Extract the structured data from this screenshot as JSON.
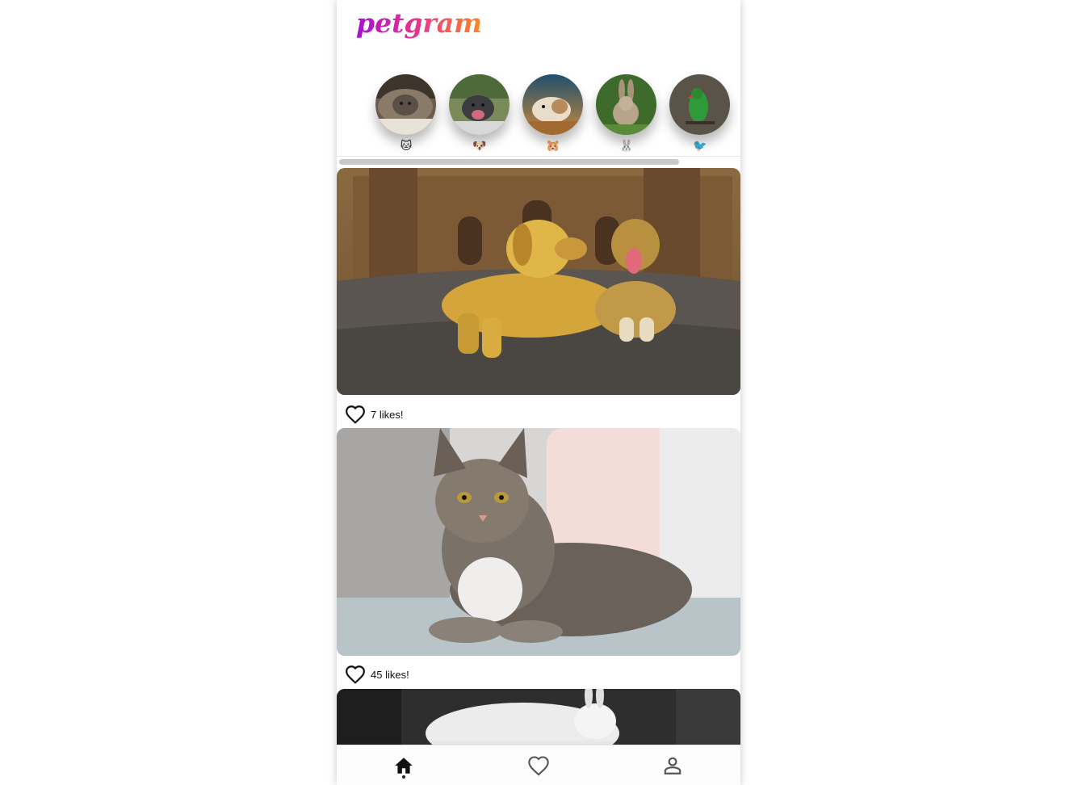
{
  "app": {
    "logo_text": "petgram",
    "logo_gradient": [
      "#a90fd6",
      "#e8368a",
      "#ff8a1e"
    ]
  },
  "categories": [
    {
      "emoji": "🐱",
      "icon": "cat-icon"
    },
    {
      "emoji": "🐶",
      "icon": "dog-icon"
    },
    {
      "emoji": "🐹",
      "icon": "hamster-icon"
    },
    {
      "emoji": "🐰",
      "icon": "rabbit-icon"
    },
    {
      "emoji": "🐦",
      "icon": "bird-icon"
    }
  ],
  "posts": [
    {
      "subject": "two dogs in plaza",
      "likes_label": "7 likes!"
    },
    {
      "subject": "tabby cat on sofa",
      "likes_label": "45 likes!"
    },
    {
      "subject": "white rabbit"
    }
  ],
  "nav": {
    "items": [
      "home-icon",
      "heart-icon",
      "user-icon"
    ],
    "active": "home"
  },
  "colors": {
    "heart_stroke": "#111111",
    "nav_icon": "#555555",
    "nav_active": "#111111"
  }
}
